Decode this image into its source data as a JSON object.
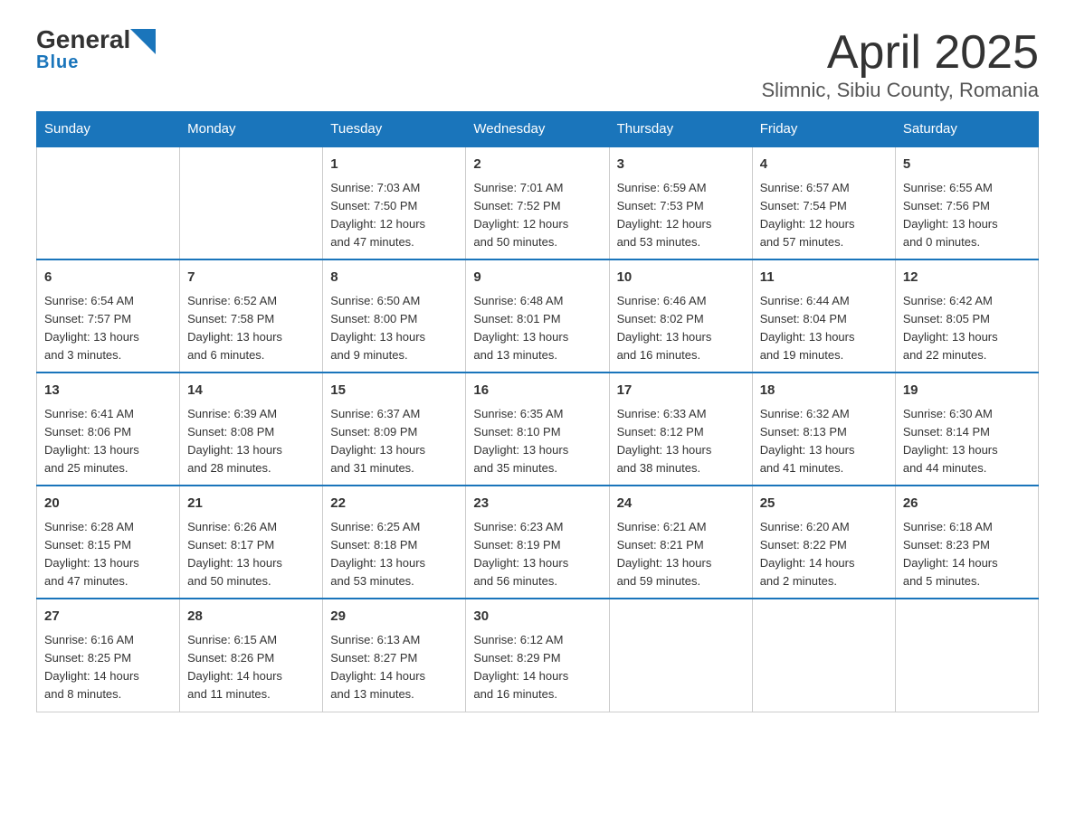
{
  "header": {
    "logo_general": "General",
    "logo_blue": "Blue",
    "month_title": "April 2025",
    "location": "Slimnic, Sibiu County, Romania"
  },
  "days_of_week": [
    "Sunday",
    "Monday",
    "Tuesday",
    "Wednesday",
    "Thursday",
    "Friday",
    "Saturday"
  ],
  "weeks": [
    [
      {
        "day": "",
        "info": ""
      },
      {
        "day": "",
        "info": ""
      },
      {
        "day": "1",
        "info": "Sunrise: 7:03 AM\nSunset: 7:50 PM\nDaylight: 12 hours\nand 47 minutes."
      },
      {
        "day": "2",
        "info": "Sunrise: 7:01 AM\nSunset: 7:52 PM\nDaylight: 12 hours\nand 50 minutes."
      },
      {
        "day": "3",
        "info": "Sunrise: 6:59 AM\nSunset: 7:53 PM\nDaylight: 12 hours\nand 53 minutes."
      },
      {
        "day": "4",
        "info": "Sunrise: 6:57 AM\nSunset: 7:54 PM\nDaylight: 12 hours\nand 57 minutes."
      },
      {
        "day": "5",
        "info": "Sunrise: 6:55 AM\nSunset: 7:56 PM\nDaylight: 13 hours\nand 0 minutes."
      }
    ],
    [
      {
        "day": "6",
        "info": "Sunrise: 6:54 AM\nSunset: 7:57 PM\nDaylight: 13 hours\nand 3 minutes."
      },
      {
        "day": "7",
        "info": "Sunrise: 6:52 AM\nSunset: 7:58 PM\nDaylight: 13 hours\nand 6 minutes."
      },
      {
        "day": "8",
        "info": "Sunrise: 6:50 AM\nSunset: 8:00 PM\nDaylight: 13 hours\nand 9 minutes."
      },
      {
        "day": "9",
        "info": "Sunrise: 6:48 AM\nSunset: 8:01 PM\nDaylight: 13 hours\nand 13 minutes."
      },
      {
        "day": "10",
        "info": "Sunrise: 6:46 AM\nSunset: 8:02 PM\nDaylight: 13 hours\nand 16 minutes."
      },
      {
        "day": "11",
        "info": "Sunrise: 6:44 AM\nSunset: 8:04 PM\nDaylight: 13 hours\nand 19 minutes."
      },
      {
        "day": "12",
        "info": "Sunrise: 6:42 AM\nSunset: 8:05 PM\nDaylight: 13 hours\nand 22 minutes."
      }
    ],
    [
      {
        "day": "13",
        "info": "Sunrise: 6:41 AM\nSunset: 8:06 PM\nDaylight: 13 hours\nand 25 minutes."
      },
      {
        "day": "14",
        "info": "Sunrise: 6:39 AM\nSunset: 8:08 PM\nDaylight: 13 hours\nand 28 minutes."
      },
      {
        "day": "15",
        "info": "Sunrise: 6:37 AM\nSunset: 8:09 PM\nDaylight: 13 hours\nand 31 minutes."
      },
      {
        "day": "16",
        "info": "Sunrise: 6:35 AM\nSunset: 8:10 PM\nDaylight: 13 hours\nand 35 minutes."
      },
      {
        "day": "17",
        "info": "Sunrise: 6:33 AM\nSunset: 8:12 PM\nDaylight: 13 hours\nand 38 minutes."
      },
      {
        "day": "18",
        "info": "Sunrise: 6:32 AM\nSunset: 8:13 PM\nDaylight: 13 hours\nand 41 minutes."
      },
      {
        "day": "19",
        "info": "Sunrise: 6:30 AM\nSunset: 8:14 PM\nDaylight: 13 hours\nand 44 minutes."
      }
    ],
    [
      {
        "day": "20",
        "info": "Sunrise: 6:28 AM\nSunset: 8:15 PM\nDaylight: 13 hours\nand 47 minutes."
      },
      {
        "day": "21",
        "info": "Sunrise: 6:26 AM\nSunset: 8:17 PM\nDaylight: 13 hours\nand 50 minutes."
      },
      {
        "day": "22",
        "info": "Sunrise: 6:25 AM\nSunset: 8:18 PM\nDaylight: 13 hours\nand 53 minutes."
      },
      {
        "day": "23",
        "info": "Sunrise: 6:23 AM\nSunset: 8:19 PM\nDaylight: 13 hours\nand 56 minutes."
      },
      {
        "day": "24",
        "info": "Sunrise: 6:21 AM\nSunset: 8:21 PM\nDaylight: 13 hours\nand 59 minutes."
      },
      {
        "day": "25",
        "info": "Sunrise: 6:20 AM\nSunset: 8:22 PM\nDaylight: 14 hours\nand 2 minutes."
      },
      {
        "day": "26",
        "info": "Sunrise: 6:18 AM\nSunset: 8:23 PM\nDaylight: 14 hours\nand 5 minutes."
      }
    ],
    [
      {
        "day": "27",
        "info": "Sunrise: 6:16 AM\nSunset: 8:25 PM\nDaylight: 14 hours\nand 8 minutes."
      },
      {
        "day": "28",
        "info": "Sunrise: 6:15 AM\nSunset: 8:26 PM\nDaylight: 14 hours\nand 11 minutes."
      },
      {
        "day": "29",
        "info": "Sunrise: 6:13 AM\nSunset: 8:27 PM\nDaylight: 14 hours\nand 13 minutes."
      },
      {
        "day": "30",
        "info": "Sunrise: 6:12 AM\nSunset: 8:29 PM\nDaylight: 14 hours\nand 16 minutes."
      },
      {
        "day": "",
        "info": ""
      },
      {
        "day": "",
        "info": ""
      },
      {
        "day": "",
        "info": ""
      }
    ]
  ]
}
